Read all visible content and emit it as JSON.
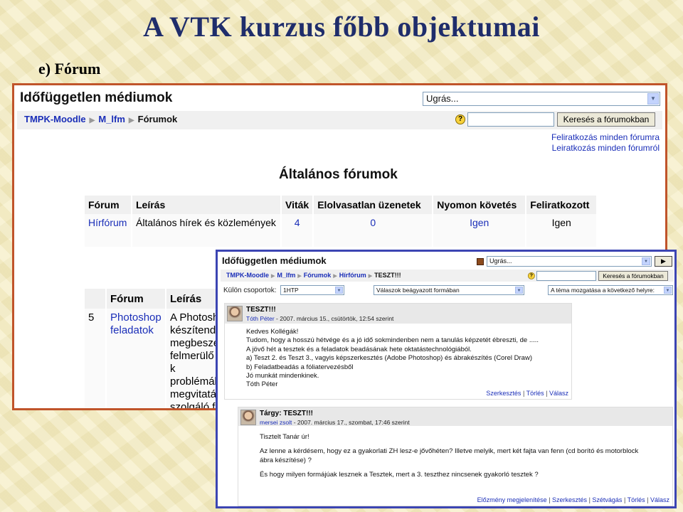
{
  "slide": {
    "title": "A VTK kurzus főbb objektumai",
    "subtitle": "e) Fórum"
  },
  "shot1": {
    "site_name": "Időfüggetlen médiumok",
    "jump_select": "Ugrás...",
    "breadcrumb": [
      "TMPK-Moodle",
      "M_lfm",
      "Fórumok"
    ],
    "search_button": "Keresés a fórumokban",
    "subscribe_all": "Feliratkozás minden fórumra",
    "unsubscribe_all": "Leiratkozás minden fórumról",
    "section_title": "Általános fórumok",
    "table_headers": [
      "Fórum",
      "Leírás",
      "Viták",
      "Elolvasatlan üzenetek",
      "Nyomon követés",
      "Feliratkozott"
    ],
    "rows": [
      {
        "forum": "Hírfórum",
        "description": "Általános hírek és közlemények",
        "discussions": "4",
        "unread": "0",
        "tracking": "Igen",
        "subscribed": "Igen"
      }
    ],
    "table2_headers": [
      "Fórum",
      "Leírás"
    ],
    "table2_row": {
      "num": "5",
      "forum": "Photoshop feladatok",
      "description_lines": [
        "A Photosh",
        "készítend",
        "megbeszé",
        "felmerülő k",
        "problémák",
        "megvitatás",
        "szolgáló fó"
      ]
    }
  },
  "shot2": {
    "site_name": "Időfüggetlen médiumok",
    "jump_select": "Ugrás...",
    "go_button": "▶",
    "breadcrumb": [
      "TMPK-Moodle",
      "M_lfm",
      "Fórumok",
      "Hírfórum",
      "TESZT!!!"
    ],
    "search_button": "Keresés a fórumokban",
    "group_label": "Külön csoportok:",
    "group_select": "1HTP",
    "display_select": "Válaszok beágyazott formában",
    "move_select": "A téma mozgatása a következő helyre:",
    "posts": [
      {
        "subject": "TESZT!!!",
        "author": "Tóth Péter",
        "date": " - 2007. március 15., csütörtök, 12:54 szerint",
        "body": [
          "Kedves Kollégák!",
          "Tudom, hogy a hosszú hétvége és a jó idő sokmindenben nem a tanulás képzetét ébreszti, de .....",
          "A jövő hét a tesztek és a feladatok beadásának hete oktatástechnológiából.",
          "a) Teszt 2. és Teszt 3., vagyis képszerkesztés (Adobe Photoshop) és ábrakészítés (Corel Draw)",
          "b) Feladatbeadás a fóliatervezésből",
          "Jó munkát mindenkinek.",
          "Tóth Péter"
        ],
        "links": [
          "Szerkesztés",
          "Törlés",
          "Válasz"
        ]
      },
      {
        "subject": "Tárgy: TESZT!!!",
        "author": "mersei zsolt",
        "date": " - 2007. március 17., szombat, 17:46 szerint",
        "body": [
          "Tisztelt Tanár úr!",
          "",
          "Az lenne a kérdésem, hogy ez a gyakorlati ZH lesz-e jővőhéten? Illetve melyik, mert két fajta van fenn (cd borító és motorblock",
          "ábra készítése) ?",
          "",
          "És hogy milyen formájúak lesznek a Tesztek, mert a 3. teszthez nincsenek gyakorló tesztek ?"
        ],
        "links": [
          "Előzmény megjelenítése",
          "Szerkesztés",
          "Szétvágás",
          "Törlés",
          "Válasz"
        ]
      }
    ]
  },
  "colors": {
    "shot1_border": "#c0542a",
    "shot2_border": "#3c45b3",
    "link": "#1a2eb8",
    "title": "#1f2d6b"
  }
}
